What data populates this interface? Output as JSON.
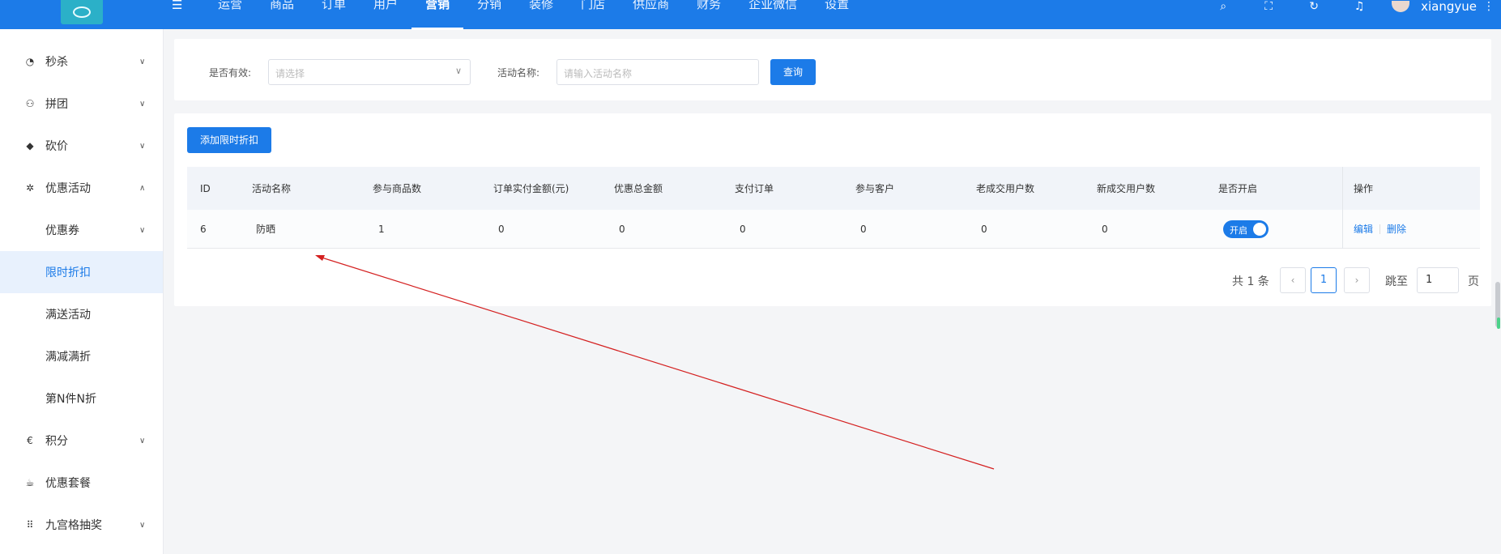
{
  "topbar": {
    "menu_icon": "menu-fold-icon",
    "nav": [
      "运营",
      "商品",
      "订单",
      "用户",
      "营销",
      "分销",
      "装修",
      "门店",
      "供应商",
      "财务",
      "企业微信",
      "设置"
    ],
    "active_nav": "营销",
    "username": "xiangyue",
    "icons": [
      "search-icon",
      "fullscreen-icon",
      "refresh-icon",
      "bell-icon"
    ]
  },
  "sidebar": {
    "items": [
      {
        "label": "秒杀",
        "icon": "clock-icon",
        "chevron": "down"
      },
      {
        "label": "拼团",
        "icon": "group-icon",
        "chevron": "down"
      },
      {
        "label": "砍价",
        "icon": "tag-icon",
        "chevron": "down"
      },
      {
        "label": "优惠活动",
        "icon": "gift-icon",
        "chevron": "up"
      },
      {
        "label": "优惠券",
        "chevron": "down"
      },
      {
        "label": "限时折扣",
        "active": true
      },
      {
        "label": "满送活动"
      },
      {
        "label": "满减满折"
      },
      {
        "label": "第N件N折"
      },
      {
        "label": "积分",
        "icon": "euro-icon",
        "chevron": "down"
      },
      {
        "label": "优惠套餐",
        "icon": "cup-icon"
      },
      {
        "label": "九宫格抽奖",
        "icon": "grid-icon",
        "chevron": "down"
      }
    ]
  },
  "filter": {
    "valid_label": "是否有效:",
    "valid_placeholder": "请选择",
    "name_label": "活动名称:",
    "name_placeholder": "请输入活动名称",
    "query_button": "查询"
  },
  "main": {
    "add_button": "添加限时折扣",
    "table": {
      "headers": [
        "ID",
        "活动名称",
        "参与商品数",
        "订单实付金额(元)",
        "优惠总金额",
        "支付订单",
        "参与客户",
        "老成交用户数",
        "新成交用户数",
        "是否开启",
        "操作"
      ],
      "rows": [
        {
          "id": "6",
          "name": "防晒",
          "goods": "1",
          "paid": "0",
          "discount": "0",
          "orders": "0",
          "customers": "0",
          "old_users": "0",
          "new_users": "0",
          "enabled_label": "开启",
          "enabled": true,
          "edit": "编辑",
          "delete": "删除"
        }
      ]
    }
  },
  "pagination": {
    "total": "共 1 条",
    "current_page": "1",
    "goto_label": "跳至",
    "goto_value": "1",
    "page_suffix": "页"
  },
  "colors": {
    "primary": "#1c7be8",
    "annotation": "#d42020"
  }
}
